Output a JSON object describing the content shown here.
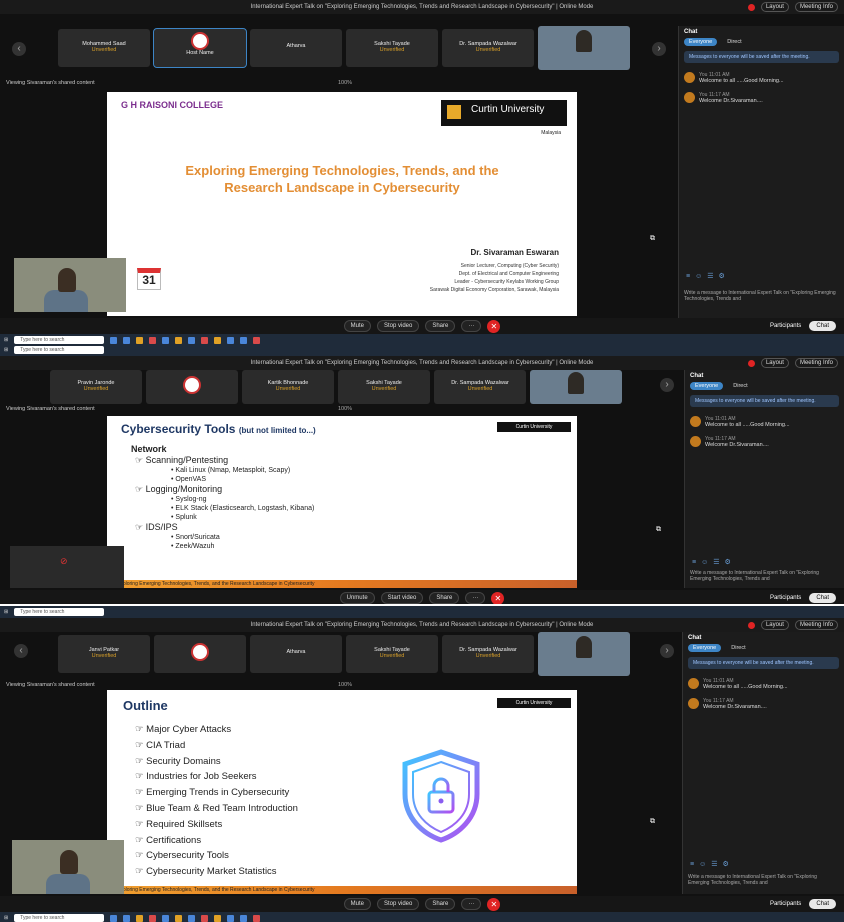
{
  "meeting_title": "International Expert Talk on \"Exploring Emerging Technologies, Trends and Research Landscape in Cybersecurity\" | Online Mode",
  "header_buttons": {
    "layout": "Layout",
    "meeting_info": "Meeting Info"
  },
  "viewing_label": "Viewing Sivaraman's shared content",
  "zoom": "100%",
  "strip1": [
    {
      "name": "Mohammed Saad",
      "status": "Unverified"
    },
    {
      "name": "Host Name",
      "status": ""
    },
    {
      "name": "Atharva",
      "status": ""
    },
    {
      "name": "Sakshi Tayade",
      "status": "Unverified"
    },
    {
      "name": "Dr. Sampada Wazalwar",
      "status": "Unverified"
    }
  ],
  "strip2": [
    {
      "name": "Pravin Jaronde",
      "status": "Unverified"
    },
    {
      "name": "",
      "status": ""
    },
    {
      "name": "Kartik Bhonnade",
      "status": "Unverified"
    },
    {
      "name": "Sakshi Tayade",
      "status": "Unverified"
    },
    {
      "name": "Dr. Sampada Wazalwar",
      "status": "Unverified"
    }
  ],
  "strip3": [
    {
      "name": "Janvi Patkar",
      "status": "Unverified"
    },
    {
      "name": "",
      "status": ""
    },
    {
      "name": "Atharva",
      "status": ""
    },
    {
      "name": "Sakshi Tayade",
      "status": "Unverified"
    },
    {
      "name": "Dr. Sampada Wazalwar",
      "status": "Unverified"
    }
  ],
  "slide1": {
    "college": "G H RAISONI COLLEGE",
    "university": "Curtin University",
    "campus": "Malaysia",
    "title_line1": "Exploring Emerging Technologies, Trends, and the",
    "title_line2": "Research Landscape in Cybersecurity",
    "speaker": "Dr. Sivaraman Eswaran",
    "lines": [
      "Senior Lecturer, Computing (Cyber Security)",
      "Dept. of Electrical and Computer Engineering",
      "Leader - Cybersecurity Keylabs Working Group",
      "Sarawak Digital Economy Corporation, Sarawak, Malaysia"
    ]
  },
  "slide2": {
    "title": "Cybersecurity Tools",
    "subtitle": "(but not limited to...)",
    "section": "Network",
    "groups": [
      {
        "head": "Scanning/Pentesting",
        "items": [
          "Kali Linux (Nmap, Metasploit, Scapy)",
          "OpenVAS"
        ]
      },
      {
        "head": "Logging/Monitoring",
        "items": [
          "Syslog-ng",
          "ELK Stack (Elasticsearch, Logstash, Kibana)",
          "Splunk"
        ]
      },
      {
        "head": "IDS/IPS",
        "items": [
          "Snort/Suricata",
          "Zeek/Wazuh"
        ]
      }
    ],
    "footer": "Exploring Emerging Technologies, Trends, and the Research Landscape in Cybersecurity"
  },
  "slide3": {
    "title": "Outline",
    "items": [
      "Major Cyber Attacks",
      "CIA Triad",
      "Security Domains",
      "Industries for Job Seekers",
      "Emerging Trends in Cybersecurity",
      "Blue Team & Red Team Introduction",
      "Required Skillsets",
      "Certifications",
      "Cybersecurity Tools",
      "Cybersecurity Market Statistics"
    ],
    "footer": "Exploring Emerging Technologies, Trends, and the Research Landscape in Cybersecurity"
  },
  "chat": {
    "header": "Chat",
    "tab_everyone": "Everyone",
    "tab_direct": "Direct",
    "notice": "Messages to everyone will be saved after the meeting.",
    "messages": [
      {
        "time": "You 11:01 AM",
        "text": "Welcome to all .....Good Morning..."
      },
      {
        "time": "You 11:17 AM",
        "text": "Welcome Dr.Sivaraman...."
      }
    ],
    "input_placeholder": "Write a message to International Expert Talk on \"Exploring Emerging Technologies, Trends and"
  },
  "toolbar": {
    "mute": "Mute",
    "stop_video": "Stop video",
    "start_video": "Start video",
    "share": "Share",
    "participants": "Participants",
    "chat": "Chat"
  },
  "taskbar": {
    "search": "Type here to search"
  },
  "calendar_day": "31"
}
